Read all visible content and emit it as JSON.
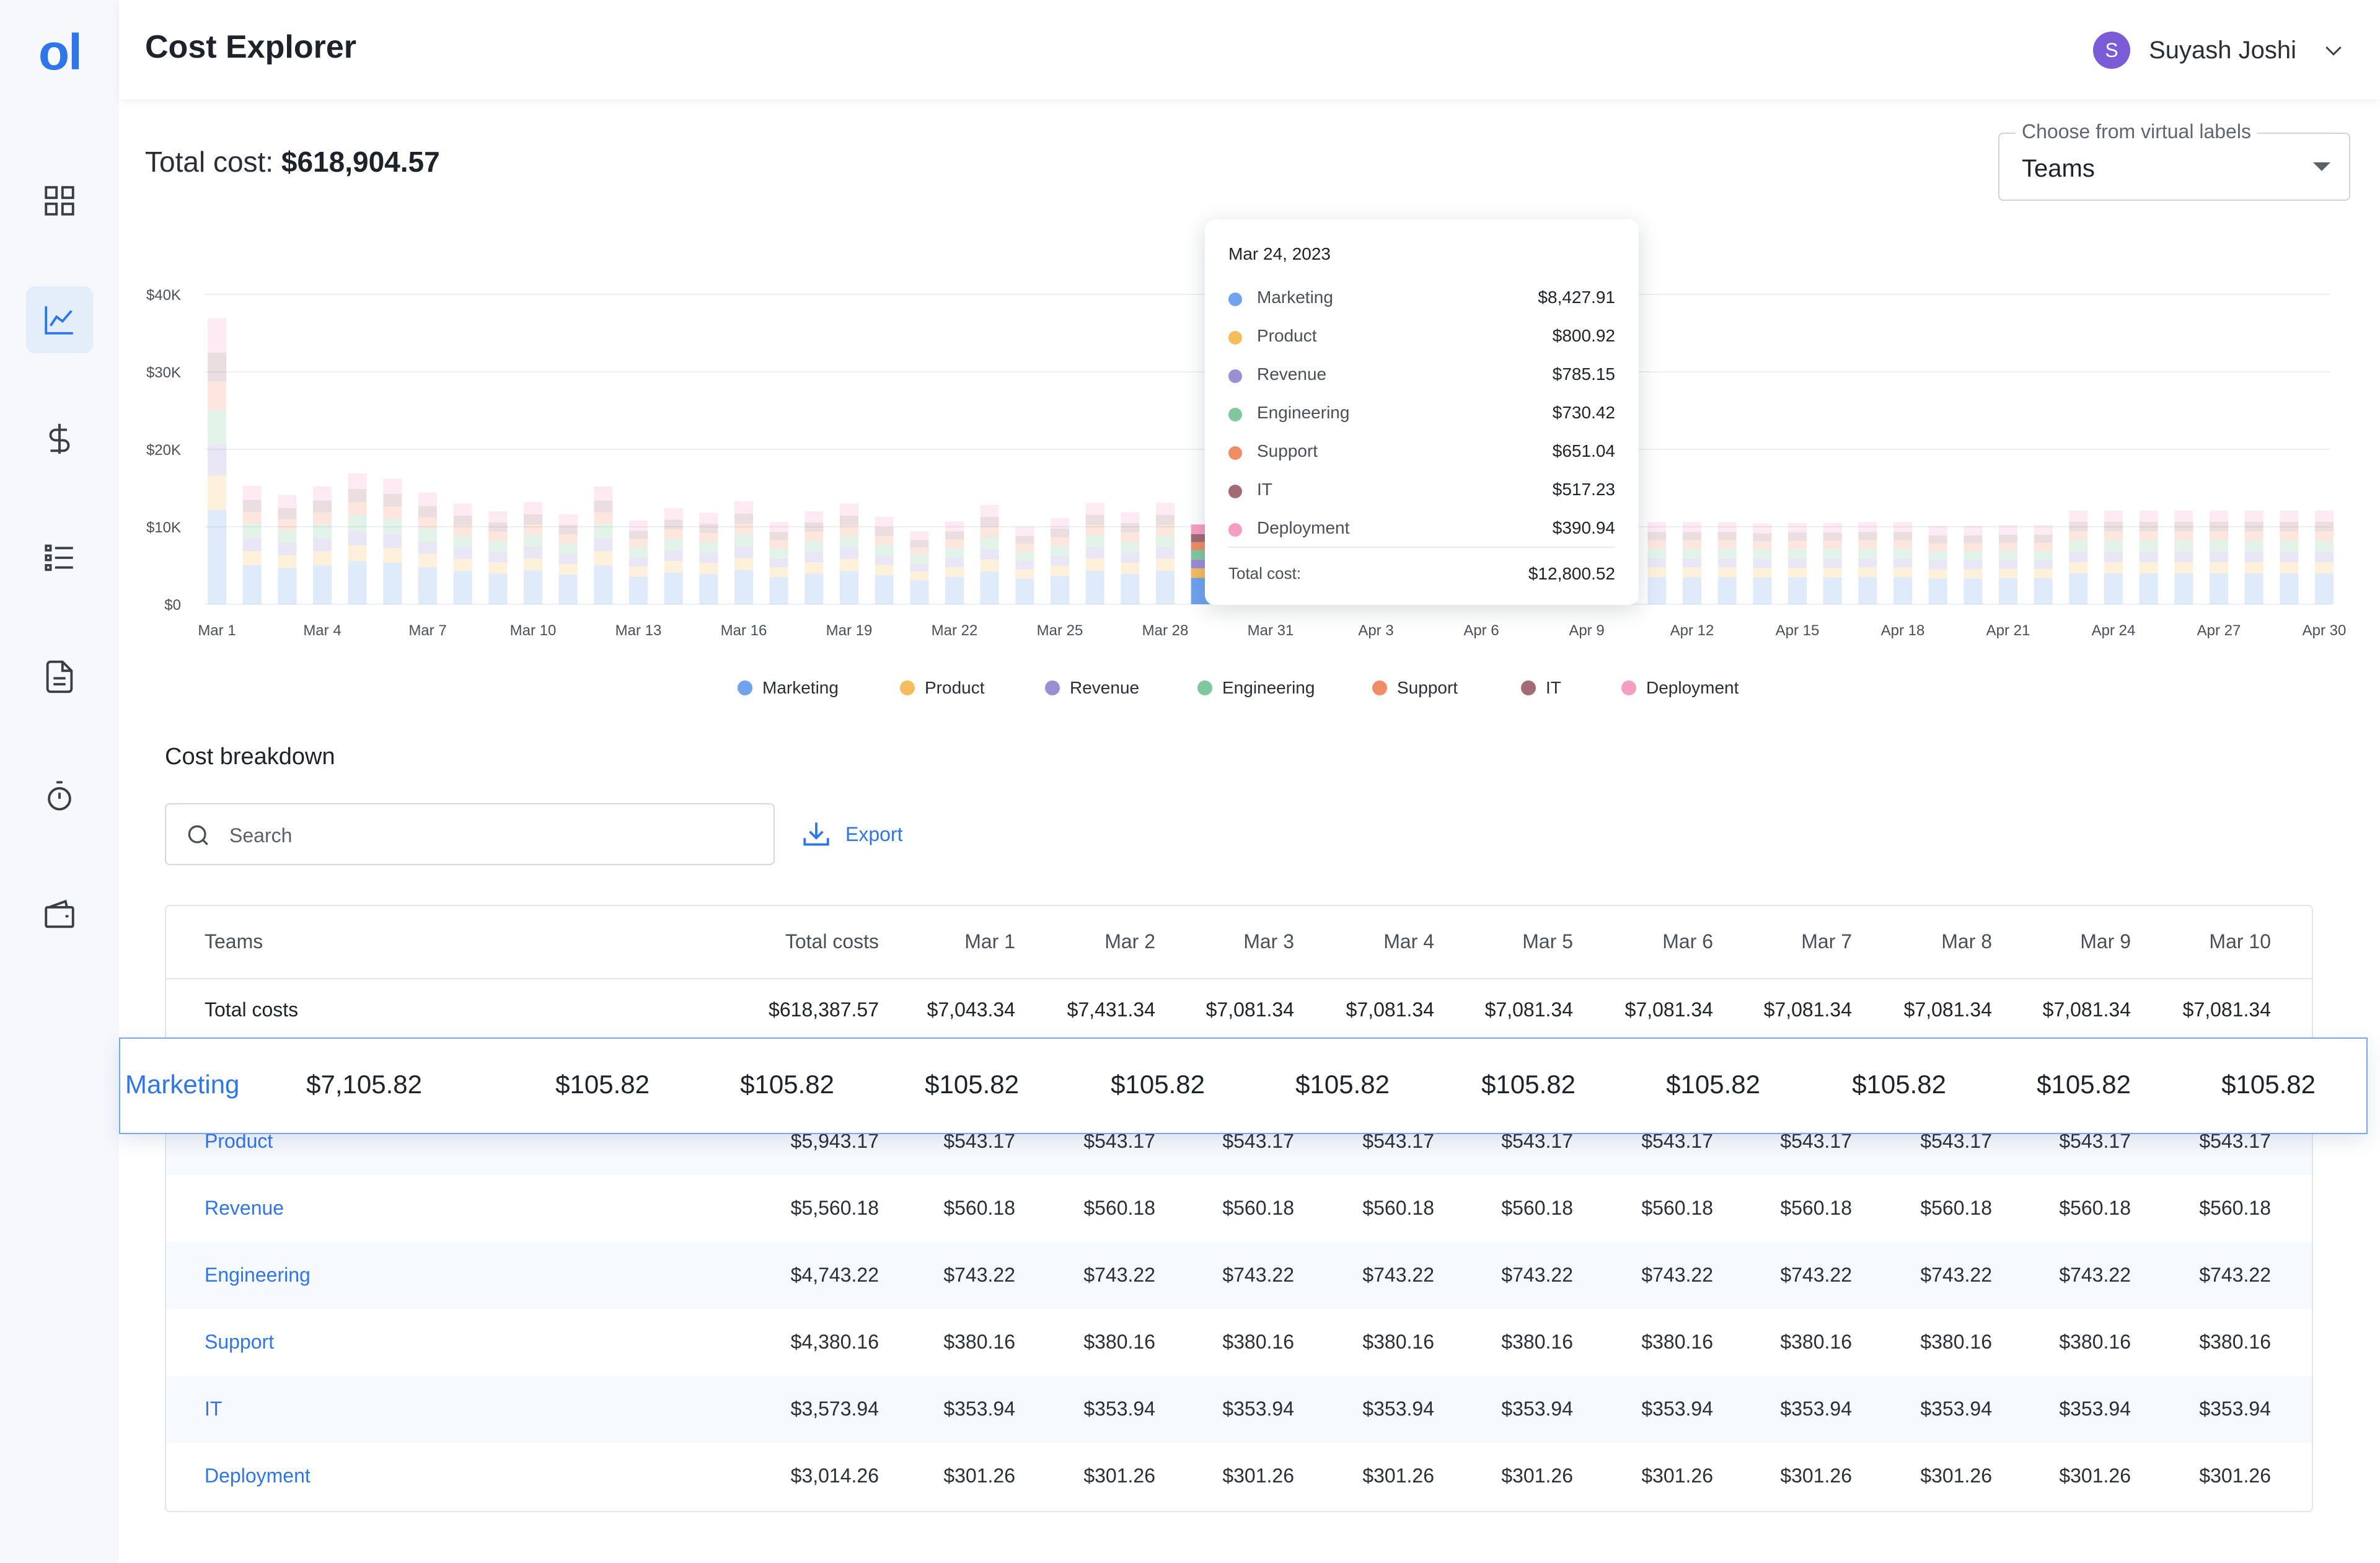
{
  "app": {
    "logo_text": "ol",
    "page_title": "Cost Explorer",
    "user": {
      "initial": "S",
      "name": "Suyash Joshi"
    }
  },
  "sidebar": {
    "items": [
      {
        "icon": "dashboard-icon"
      },
      {
        "icon": "line-chart-icon",
        "active": true
      },
      {
        "icon": "dollar-icon"
      },
      {
        "icon": "list-icon"
      },
      {
        "icon": "document-icon"
      },
      {
        "icon": "timer-icon"
      },
      {
        "icon": "wallet-icon"
      }
    ]
  },
  "summary": {
    "total_label": "Total cost:",
    "total_value": "$618,904.57"
  },
  "label_select": {
    "label": "Choose from virtual labels",
    "value": "Teams"
  },
  "colors": {
    "accent": "#2f76e8",
    "Marketing": "#6fa3ee",
    "Product": "#f5bd5e",
    "Revenue": "#9c8ed4",
    "Engineering": "#80c7a0",
    "Support": "#f08d65",
    "IT": "#a36b74",
    "Deployment": "#f59ec2"
  },
  "chart_data": {
    "type": "bar",
    "stacked": true,
    "yticks": [
      "$40K",
      "$30K",
      "$20K",
      "$10K",
      "$0"
    ],
    "ylim": [
      0,
      40000
    ],
    "xtick_labels": [
      "Mar 1",
      "Mar 4",
      "Mar 7",
      "Mar 10",
      "Mar 13",
      "Mar 16",
      "Mar 19",
      "Mar 22",
      "Mar 25",
      "Mar 28",
      "Mar 31",
      "Apr 3",
      "Apr 6",
      "Apr 9",
      "Apr 12",
      "Apr 15",
      "Apr 18",
      "Apr 21",
      "Apr 24",
      "Apr 27",
      "Apr 30"
    ],
    "series_names": [
      "Marketing",
      "Product",
      "Revenue",
      "Engineering",
      "Support",
      "IT",
      "Deployment"
    ],
    "totals": [
      36900,
      15300,
      14100,
      15200,
      16900,
      16200,
      14400,
      13000,
      12000,
      13200,
      11600,
      15200,
      10800,
      12400,
      11800,
      13300,
      10600,
      12000,
      13000,
      11300,
      9400,
      10700,
      12800,
      10000,
      11100,
      13100,
      11900,
      13100,
      10300,
      12000,
      9700,
      12800,
      12800,
      12800,
      12900,
      10500,
      10600,
      10600,
      10600,
      10600,
      10600,
      10600,
      10600,
      10600,
      10400,
      10500,
      10500,
      10600,
      10600,
      10100,
      10100,
      10200,
      10200,
      12100,
      12100,
      12100,
      12100,
      12100,
      12100,
      12100,
      12100
    ],
    "highlight_index": 28,
    "legend_position": "bottom"
  },
  "tooltip": {
    "date": "Mar 24, 2023",
    "rows": [
      {
        "name": "Marketing",
        "value": "$8,427.91"
      },
      {
        "name": "Product",
        "value": "$800.92"
      },
      {
        "name": "Revenue",
        "value": "$785.15"
      },
      {
        "name": "Engineering",
        "value": "$730.42"
      },
      {
        "name": "Support",
        "value": "$651.04"
      },
      {
        "name": "IT",
        "value": "$517.23"
      },
      {
        "name": "Deployment",
        "value": "$390.94"
      }
    ],
    "total_label": "Total cost:",
    "total_value": "$12,800.52"
  },
  "legend": [
    "Marketing",
    "Product",
    "Revenue",
    "Engineering",
    "Support",
    "IT",
    "Deployment"
  ],
  "breakdown": {
    "title": "Cost breakdown",
    "search_placeholder": "Search",
    "export_label": "Export",
    "headers": [
      "Teams",
      "Total costs",
      "Mar 1",
      "Mar 2",
      "Mar 3",
      "Mar 4",
      "Mar 5",
      "Mar 6",
      "Mar 7",
      "Mar 8",
      "Mar 9",
      "Mar 10"
    ],
    "total_row": [
      "Total costs",
      "$618,387.57",
      "$7,043.34",
      "$7,431.34",
      "$7,081.34",
      "$7,081.34",
      "$7,081.34",
      "$7,081.34",
      "$7,081.34",
      "$7,081.34",
      "$7,081.34",
      "$7,081.34"
    ],
    "highlighted_row": [
      "Marketing",
      "$7,105.82",
      "$105.82",
      "$105.82",
      "$105.82",
      "$105.82",
      "$105.82",
      "$105.82",
      "$105.82",
      "$105.82",
      "$105.82",
      "$105.82"
    ],
    "rows": [
      [
        "Product",
        "$5,943.17",
        "$543.17",
        "$543.17",
        "$543.17",
        "$543.17",
        "$543.17",
        "$543.17",
        "$543.17",
        "$543.17",
        "$543.17",
        "$543.17"
      ],
      [
        "Revenue",
        "$5,560.18",
        "$560.18",
        "$560.18",
        "$560.18",
        "$560.18",
        "$560.18",
        "$560.18",
        "$560.18",
        "$560.18",
        "$560.18",
        "$560.18"
      ],
      [
        "Engineering",
        "$4,743.22",
        "$743.22",
        "$743.22",
        "$743.22",
        "$743.22",
        "$743.22",
        "$743.22",
        "$743.22",
        "$743.22",
        "$743.22",
        "$743.22"
      ],
      [
        "Support",
        "$4,380.16",
        "$380.16",
        "$380.16",
        "$380.16",
        "$380.16",
        "$380.16",
        "$380.16",
        "$380.16",
        "$380.16",
        "$380.16",
        "$380.16"
      ],
      [
        "IT",
        "$3,573.94",
        "$353.94",
        "$353.94",
        "$353.94",
        "$353.94",
        "$353.94",
        "$353.94",
        "$353.94",
        "$353.94",
        "$353.94",
        "$353.94"
      ],
      [
        "Deployment",
        "$3,014.26",
        "$301.26",
        "$301.26",
        "$301.26",
        "$301.26",
        "$301.26",
        "$301.26",
        "$301.26",
        "$301.26",
        "$301.26",
        "$301.26"
      ]
    ]
  }
}
